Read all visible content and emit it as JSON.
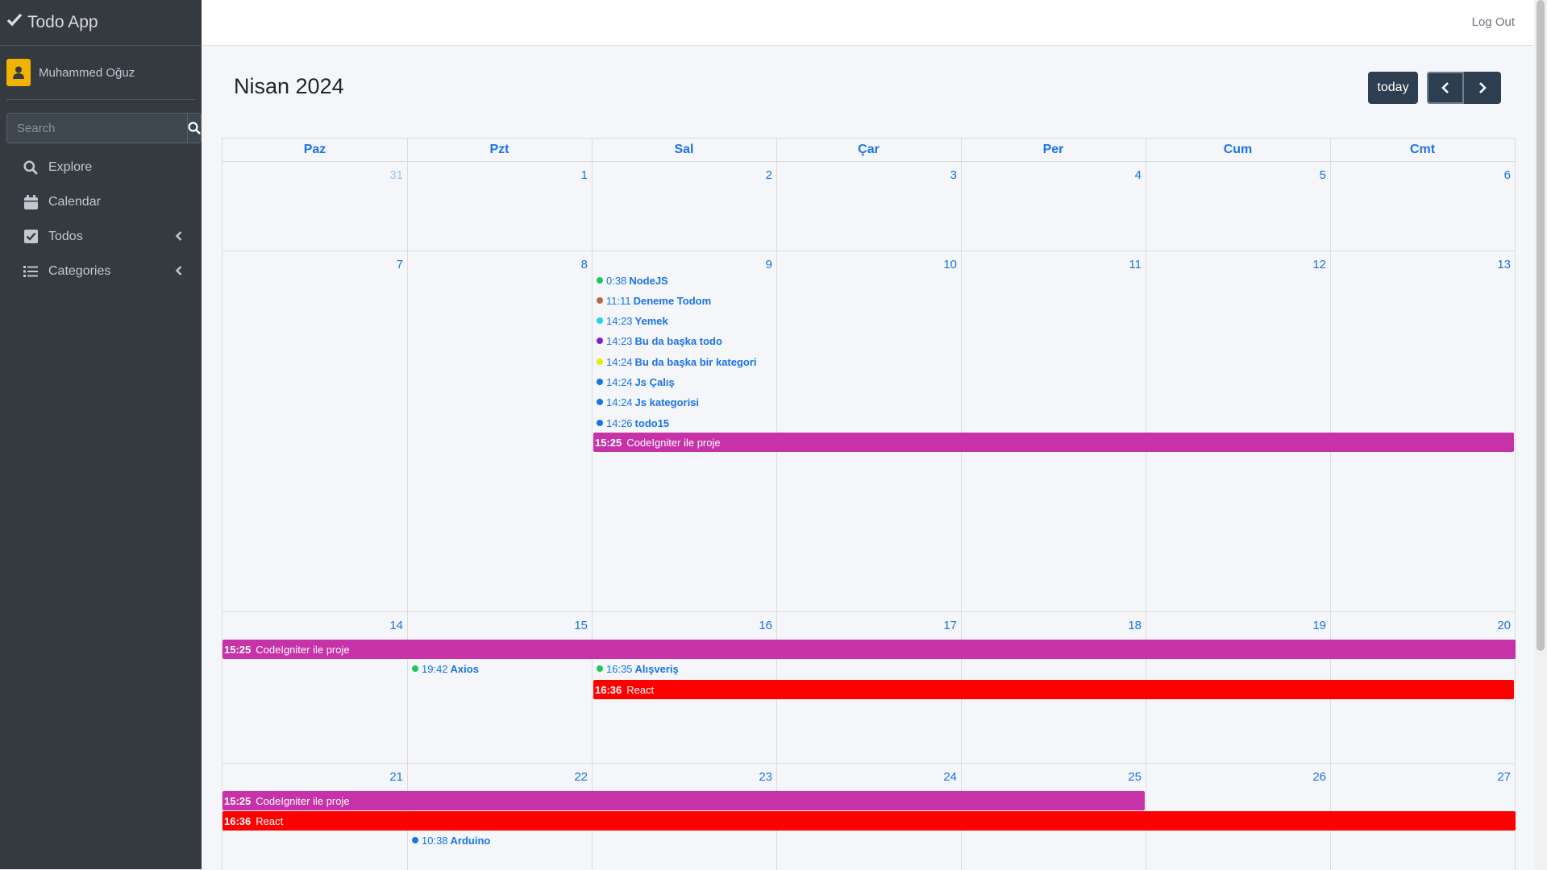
{
  "brand": {
    "title": "Todo App"
  },
  "user": {
    "name": "Muhammed Oğuz"
  },
  "search": {
    "placeholder": "Search"
  },
  "nav": [
    {
      "label": "Explore",
      "icon": "search-icon"
    },
    {
      "label": "Calendar",
      "icon": "calendar-icon"
    },
    {
      "label": "Todos",
      "icon": "check-square-icon",
      "chevron": true
    },
    {
      "label": "Categories",
      "icon": "list-icon",
      "chevron": true
    }
  ],
  "topbar": {
    "logout": "Log Out"
  },
  "calendar": {
    "title": "Nisan 2024",
    "today_label": "today",
    "days": [
      "Paz",
      "Pzt",
      "Sal",
      "Çar",
      "Per",
      "Cum",
      "Cmt"
    ],
    "weeks": [
      {
        "dates": [
          "31",
          "1",
          "2",
          "3",
          "4",
          "5",
          "6"
        ],
        "other": [
          true,
          false,
          false,
          false,
          false,
          false,
          false
        ]
      },
      {
        "dates": [
          "7",
          "8",
          "9",
          "10",
          "11",
          "12",
          "13"
        ],
        "other": [
          false,
          false,
          false,
          false,
          false,
          false,
          false
        ]
      },
      {
        "dates": [
          "14",
          "15",
          "16",
          "17",
          "18",
          "19",
          "20"
        ],
        "other": [
          false,
          false,
          false,
          false,
          false,
          false,
          false
        ]
      },
      {
        "dates": [
          "21",
          "22",
          "23",
          "24",
          "25",
          "26",
          "27"
        ],
        "other": [
          false,
          false,
          false,
          false,
          false,
          false,
          false
        ]
      }
    ],
    "events": {
      "apr9": [
        {
          "time": "0:38",
          "title": "NodeJS",
          "color": "#22c55e"
        },
        {
          "time": "11:11",
          "title": "Deneme Todom",
          "color": "#b7684a"
        },
        {
          "time": "14:23",
          "title": "Yemek",
          "color": "#22d3ee"
        },
        {
          "time": "14:23",
          "title": "Bu da başka todo",
          "color": "#7e22ce"
        },
        {
          "time": "14:24",
          "title": "Bu da başka bir kategori",
          "color": "#e4f000"
        },
        {
          "time": "14:24",
          "title": "Js Çalış",
          "color": "#1a73e8"
        },
        {
          "time": "14:24",
          "title": "Js kategorisi",
          "color": "#1a73e8"
        },
        {
          "time": "14:26",
          "title": "todo15",
          "color": "#1a73e8"
        }
      ],
      "apr15": {
        "time": "19:42",
        "title": "Axios",
        "color": "#22c55e"
      },
      "apr16": {
        "time": "16:35",
        "title": "Alışveriş",
        "color": "#22c55e"
      },
      "apr22": {
        "time": "10:38",
        "title": "Arduino",
        "color": "#1a73e8"
      },
      "codeigniter": {
        "time": "15:25",
        "title": "CodeIgniter ile proje",
        "color": "#c832a8"
      },
      "react": {
        "time": "16:36",
        "title": "React",
        "color": "#ff0000"
      }
    }
  }
}
